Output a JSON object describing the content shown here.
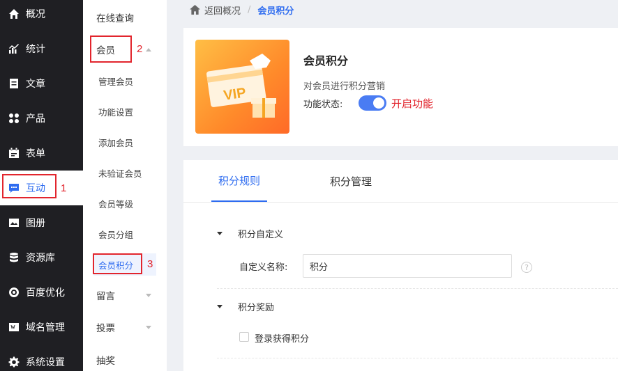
{
  "sidebar": {
    "items": [
      {
        "label": "概况",
        "icon": "home-icon"
      },
      {
        "label": "统计",
        "icon": "chart-icon"
      },
      {
        "label": "文章",
        "icon": "article-icon"
      },
      {
        "label": "产品",
        "icon": "product-icon"
      },
      {
        "label": "表单",
        "icon": "form-icon"
      },
      {
        "label": "互动",
        "icon": "chat-icon"
      },
      {
        "label": "图册",
        "icon": "album-icon"
      },
      {
        "label": "资源库",
        "icon": "database-icon"
      },
      {
        "label": "百度优化",
        "icon": "seo-icon"
      },
      {
        "label": "域名管理",
        "icon": "domain-icon"
      },
      {
        "label": "系统设置",
        "icon": "gear-icon"
      }
    ]
  },
  "subnav": {
    "items": [
      {
        "label": "在线查询"
      },
      {
        "label": "会员"
      },
      {
        "label": "管理会员"
      },
      {
        "label": "功能设置"
      },
      {
        "label": "添加会员"
      },
      {
        "label": "未验证会员"
      },
      {
        "label": "会员等级"
      },
      {
        "label": "会员分组"
      },
      {
        "label": "会员积分"
      },
      {
        "label": "留言"
      },
      {
        "label": "投票"
      },
      {
        "label": "抽奖"
      }
    ]
  },
  "annotations": {
    "n1": "1",
    "n2": "2",
    "n3": "3"
  },
  "breadcrumb": {
    "back": "返回概况",
    "sep": "/",
    "current": "会员积分"
  },
  "feature": {
    "title": "会员积分",
    "desc": "对会员进行积分营销",
    "status_label": "功能状态:",
    "status_text": "开启功能",
    "enabled": true,
    "vip_text": "VIP"
  },
  "tabs": [
    {
      "label": "积分规则"
    },
    {
      "label": "积分管理"
    }
  ],
  "rules": {
    "section1": "积分自定义",
    "name_label": "自定义名称:",
    "name_value": "积分",
    "help": "?",
    "section2": "积分奖励",
    "login_reward": "登录获得积分"
  },
  "colors": {
    "accent": "#2e6cf0",
    "annotation": "#e2252d",
    "sidebar_bg": "#1f1f23"
  }
}
